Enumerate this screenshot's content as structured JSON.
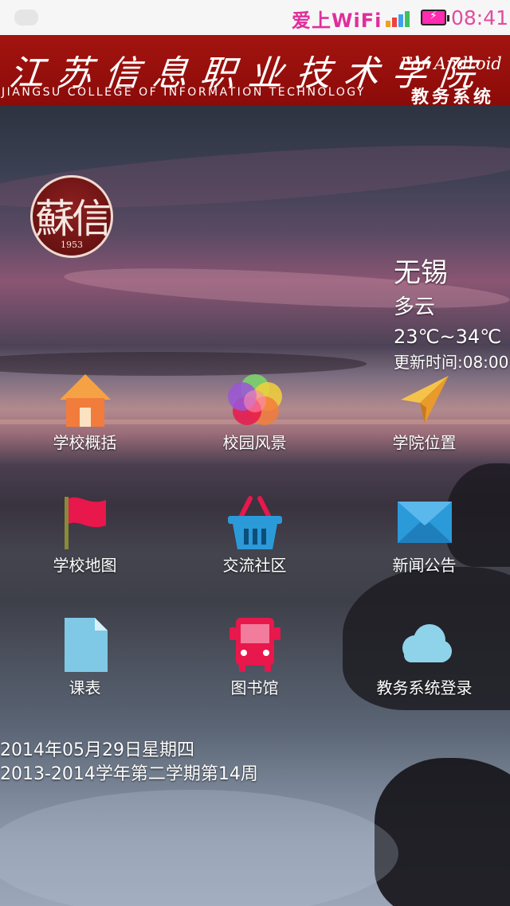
{
  "status_bar": {
    "wifi_brand": "爱上WiFi",
    "time": "08:41",
    "icons": [
      "message-icon",
      "signal-icon",
      "battery-charging-icon"
    ]
  },
  "banner": {
    "title": "江苏信息职业技术学院",
    "subtitle": "JIANGSU COLLEGE OF INFORMATION TECHNOLOGY",
    "platform": "For Android",
    "system": "教务系统",
    "color": "#9b110d"
  },
  "logo": {
    "seal_text": "蘇信",
    "year": "1953"
  },
  "weather": {
    "city": "无锡",
    "condition": "多云",
    "temperature": "23℃~34℃",
    "updated": "更新时间:08:00"
  },
  "menu": [
    {
      "label": "学校概括",
      "icon": "house-icon",
      "color": "#f27c3b"
    },
    {
      "label": "校园风景",
      "icon": "color-circles-icon",
      "color": "#e8a93a"
    },
    {
      "label": "学院位置",
      "icon": "paper-plane-icon",
      "color": "#f2b23a"
    },
    {
      "label": "学校地图",
      "icon": "flag-icon",
      "color": "#e8174c"
    },
    {
      "label": "交流社区",
      "icon": "basket-icon",
      "color": "#2b9ad9"
    },
    {
      "label": "新闻公告",
      "icon": "envelope-icon",
      "color": "#2b9ad9"
    },
    {
      "label": "课表",
      "icon": "document-icon",
      "color": "#7fc8e6"
    },
    {
      "label": "图书馆",
      "icon": "bus-icon",
      "color": "#e8174c"
    },
    {
      "label": "教务系统登录",
      "icon": "cloud-icon",
      "color": "#8fd3ea"
    }
  ],
  "date": {
    "line1": "2014年05月29日星期四",
    "line2": "2013-2014学年第二学期第14周"
  }
}
